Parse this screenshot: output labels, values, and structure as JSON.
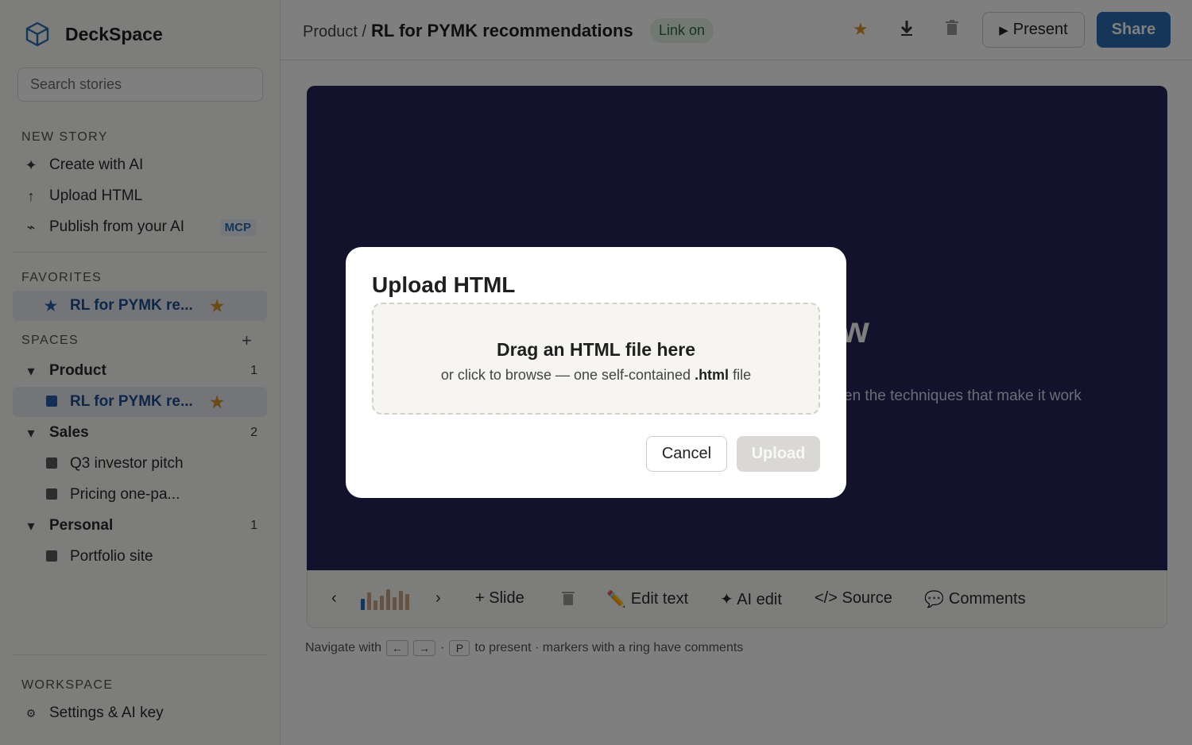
{
  "app": {
    "name": "DeckSpace"
  },
  "search": {
    "placeholder": "Search stories"
  },
  "sidebar": {
    "new_story_label": "NEW STORY",
    "new_story_items": [
      {
        "icon": "sparkle-icon",
        "glyph": "✦",
        "label": "Create with AI"
      },
      {
        "icon": "upload-arrow-icon",
        "glyph": "↑",
        "label": "Upload HTML"
      },
      {
        "icon": "plug-icon",
        "glyph": "⌁",
        "label": "Publish from your AI",
        "badge": "MCP"
      }
    ],
    "favorites_label": "FAVORITES",
    "favorites": [
      {
        "label": "RL for PYMK re...",
        "starred": true
      }
    ],
    "spaces_label": "SPACES",
    "spaces": [
      {
        "name": "Product",
        "count": "1",
        "stories": [
          {
            "label": "RL for PYMK re...",
            "starred": true,
            "active": true
          }
        ]
      },
      {
        "name": "Sales",
        "count": "2",
        "stories": [
          {
            "label": "Q3 investor pitch"
          },
          {
            "label": "Pricing one-pa..."
          }
        ]
      },
      {
        "name": "Personal",
        "count": "1",
        "stories": [
          {
            "label": "Portfolio site"
          }
        ]
      }
    ],
    "workspace_label": "WORKSPACE",
    "settings_label": "Settings & AI key"
  },
  "header": {
    "breadcrumb_parent": "Product /",
    "title": "RL for PYMK recommendations",
    "link_status": "Link on",
    "present_label": "Present",
    "share_label": "Share"
  },
  "slide": {
    "title_fragment": "w",
    "subtitle_fragment": "en the techniques that make it work",
    "background": "#26245a"
  },
  "toolbar": {
    "prev": "‹",
    "next": "›",
    "add_slide": "+ Slide",
    "edit_text": "Edit text",
    "ai_edit": "✦ AI edit",
    "source": "</> Source",
    "comments": "Comments"
  },
  "hint": {
    "prefix": "Navigate with",
    "key_left": "←",
    "key_right": "→",
    "sep": "·",
    "key_present": "P",
    "suffix": "to present · markers with a ring have comments"
  },
  "modal": {
    "title": "Upload HTML",
    "dropzone_title": "Drag an HTML file here",
    "dropzone_sub_prefix": "or click to browse — one self-contained ",
    "dropzone_sub_ext": ".html",
    "dropzone_sub_suffix": " file",
    "cancel_label": "Cancel",
    "upload_label": "Upload"
  },
  "colors": {
    "accent": "#2b6cb0",
    "star": "#d9952f",
    "link_on": "#2f6b3c"
  }
}
